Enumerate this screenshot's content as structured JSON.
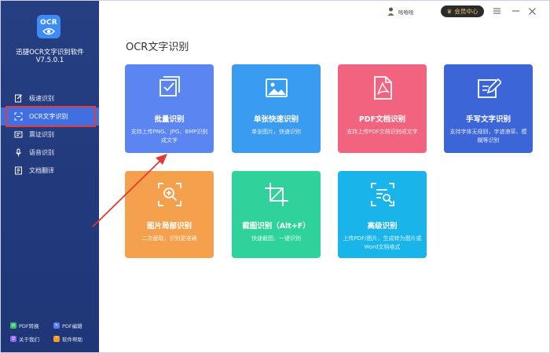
{
  "app": {
    "logo_text": "OCR",
    "name": "迅捷OCR文字识别软件",
    "version": "V7.5.0.1"
  },
  "sidebar": {
    "items": [
      {
        "label": "极速识别",
        "icon": "scan-doc-icon",
        "active": false
      },
      {
        "label": "OCR文字识别",
        "icon": "ocr-frame-icon",
        "active": true
      },
      {
        "label": "票证识别",
        "icon": "ticket-icon",
        "active": false
      },
      {
        "label": "语音识别",
        "icon": "microphone-icon",
        "active": false
      },
      {
        "label": "文档翻译",
        "icon": "translate-icon",
        "active": false
      }
    ],
    "bottom_links": [
      {
        "label": "PDF转换",
        "icon": "pdf-convert-icon",
        "color": "#3bbf6a"
      },
      {
        "label": "PDF编辑",
        "icon": "pdf-edit-icon",
        "color": "#5a7cf0"
      },
      {
        "label": "关于我们",
        "icon": "about-icon",
        "color": "#8a63e8"
      },
      {
        "label": "软件帮助",
        "icon": "help-icon",
        "color": "#f39a2b"
      }
    ]
  },
  "topbar": {
    "username": "哈哈哈",
    "vip_label": "会员中心"
  },
  "page": {
    "title": "OCR文字识别"
  },
  "cards": [
    {
      "title": "批量识别",
      "desc": "支持上传PNG、JPG、BMP识别成文字",
      "color": "#5b86f2",
      "icon": "batch-check-icon"
    },
    {
      "title": "单张快速识别",
      "desc": "单张图片，快速识别",
      "color": "#3a9cf0",
      "icon": "image-icon"
    },
    {
      "title": "PDF文档识别",
      "desc": "支持上传PDF文档识别成文字",
      "color": "#f2637f",
      "icon": "pdf-icon"
    },
    {
      "title": "手写文字识别",
      "desc": "支持字体无规则，字迹潦草、模糊等识别",
      "color": "#3c66d8",
      "icon": "handwriting-icon"
    },
    {
      "title": "图片局部识别",
      "desc": "二次截取，识别更准确",
      "color": "#f5a04c",
      "icon": "zoom-crop-icon"
    },
    {
      "title": "截图识别（Alt+F）",
      "desc": "快速截图，一键识别",
      "color": "#2ed29a",
      "icon": "crop-icon"
    },
    {
      "title": "高级识别",
      "desc": "上传PDF/图片，生成转为图片或Word文档格式",
      "color": "#19b4ea",
      "icon": "advanced-search-icon"
    }
  ]
}
